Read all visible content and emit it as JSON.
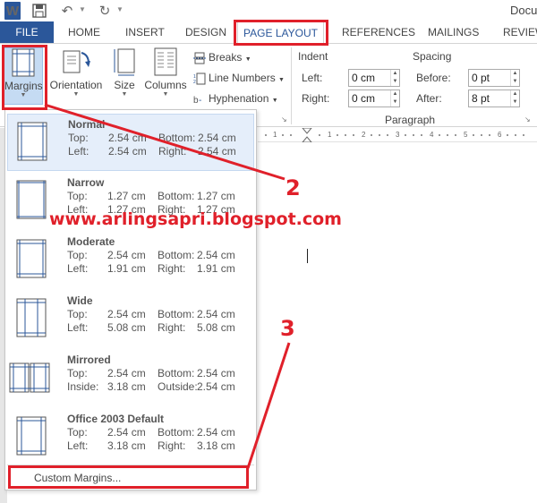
{
  "titlebar": {
    "app_icon_letter": "W",
    "doc_title": "Docu"
  },
  "tabs": [
    {
      "label": "FILE"
    },
    {
      "label": "HOME"
    },
    {
      "label": "INSERT"
    },
    {
      "label": "DESIGN"
    },
    {
      "label": "PAGE LAYOUT",
      "active": true
    },
    {
      "label": "REFERENCES"
    },
    {
      "label": "MAILINGS"
    },
    {
      "label": "REVIEW"
    }
  ],
  "ribbon": {
    "page_setup": {
      "margins_label": "Margins",
      "orientation_label": "Orientation",
      "size_label": "Size",
      "columns_label": "Columns",
      "breaks_label": "Breaks",
      "line_numbers_label": "Line Numbers",
      "hyphenation_label": "Hyphenation"
    },
    "paragraph": {
      "indent_label": "Indent",
      "spacing_label": "Spacing",
      "left_label": "Left:",
      "left_value": "0 cm",
      "right_label": "Right:",
      "right_value": "0 cm",
      "before_label": "Before:",
      "before_value": "0 pt",
      "after_label": "After:",
      "after_value": "8 pt",
      "group_label": "Paragraph"
    }
  },
  "ruler": {
    "numbers": [
      "1",
      "1",
      "2",
      "3",
      "4",
      "5",
      "6"
    ]
  },
  "margins_menu": {
    "options": [
      {
        "name": "Normal",
        "k1": "Top:",
        "v1": "2.54 cm",
        "k2": "Bottom:",
        "v2": "2.54 cm",
        "k3": "Left:",
        "v3": "2.54 cm",
        "k4": "Right:",
        "v4": "2.54 cm",
        "selected": true
      },
      {
        "name": "Narrow",
        "k1": "Top:",
        "v1": "1.27 cm",
        "k2": "Bottom:",
        "v2": "1.27 cm",
        "k3": "Left:",
        "v3": "1.27 cm",
        "k4": "Right:",
        "v4": "1.27 cm"
      },
      {
        "name": "Moderate",
        "k1": "Top:",
        "v1": "2.54 cm",
        "k2": "Bottom:",
        "v2": "2.54 cm",
        "k3": "Left:",
        "v3": "1.91 cm",
        "k4": "Right:",
        "v4": "1.91 cm"
      },
      {
        "name": "Wide",
        "k1": "Top:",
        "v1": "2.54 cm",
        "k2": "Bottom:",
        "v2": "2.54 cm",
        "k3": "Left:",
        "v3": "5.08 cm",
        "k4": "Right:",
        "v4": "5.08 cm"
      },
      {
        "name": "Mirrored",
        "k1": "Top:",
        "v1": "2.54 cm",
        "k2": "Bottom:",
        "v2": "2.54 cm",
        "k3": "Inside:",
        "v3": "3.18 cm",
        "k4": "Outside:",
        "v4": "2.54 cm"
      },
      {
        "name": "Office 2003 Default",
        "k1": "Top:",
        "v1": "2.54 cm",
        "k2": "Bottom:",
        "v2": "2.54 cm",
        "k3": "Left:",
        "v3": "3.18 cm",
        "k4": "Right:",
        "v4": "3.18 cm"
      }
    ],
    "custom_label": "Custom Margins..."
  },
  "annotations": {
    "watermark": "www.arlingsapri.blogspot.com",
    "step2": "2",
    "step3": "3",
    "color": "#e0202a"
  },
  "colors": {
    "word_blue": "#2b579a",
    "selected_bg": "#c5dbf3"
  }
}
